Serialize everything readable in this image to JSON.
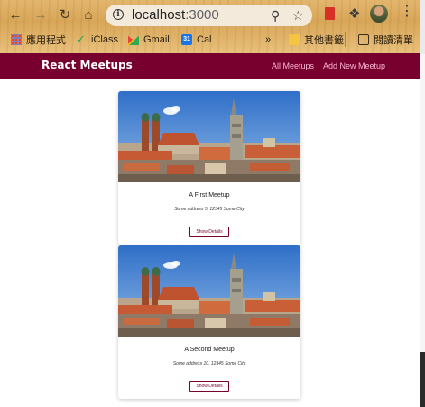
{
  "browser": {
    "url_host": "localhost",
    "url_port": ":3000",
    "bookmarks": [
      {
        "label": "應用程式",
        "icon": "apps-grid-icon"
      },
      {
        "label": "iClass",
        "icon": "iclass-icon"
      },
      {
        "label": "Gmail",
        "icon": "gmail-icon"
      },
      {
        "label": "Cal",
        "icon": "calendar-icon"
      },
      {
        "label": "其他書籤",
        "icon": "folder-icon"
      },
      {
        "label": "閱讀清單",
        "icon": "reading-list-icon"
      }
    ],
    "overflow": "»"
  },
  "app": {
    "logo": "React Meetups",
    "nav": [
      "All Meetups",
      "Add New Meetup"
    ],
    "accent_color": "#77002e"
  },
  "meetups": [
    {
      "title": "A First Meetup",
      "address": "Some address 5, 12345 Some City",
      "button": "Show Details",
      "image": "munich-frauenkirche-city-photo"
    },
    {
      "title": "A Second Meetup",
      "address": "Some address 10, 12345 Some City",
      "button": "Show Details",
      "image": "munich-frauenkirche-city-photo"
    }
  ]
}
